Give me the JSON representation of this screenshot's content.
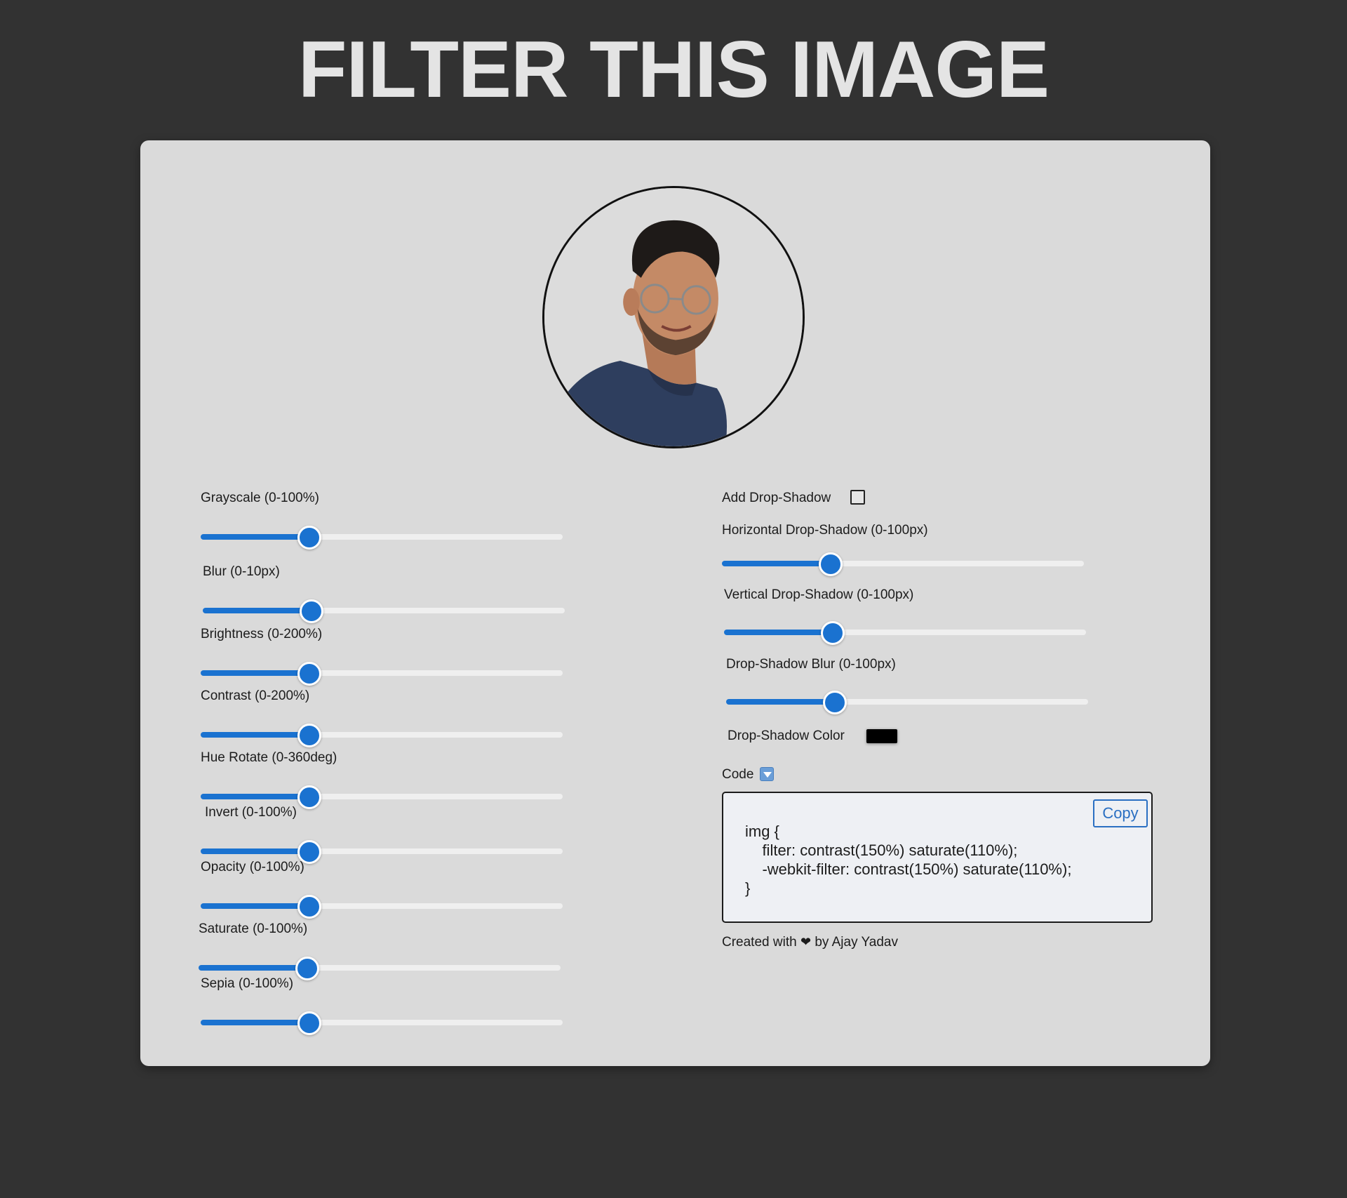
{
  "title": "FILTER THIS IMAGE",
  "colors": {
    "background": "#323232",
    "card": "#dadada",
    "accent": "#1a72d0",
    "shadow_color": "#000000"
  },
  "avatar": {
    "alt": "profile photo",
    "icon": "person-photo"
  },
  "filters": [
    {
      "label": "Grayscale (0-100%)",
      "value_fraction": 0.3
    },
    {
      "label": "Blur (0-10px)",
      "value_fraction": 0.3
    },
    {
      "label": "Brightness (0-200%)",
      "value_fraction": 0.3
    },
    {
      "label": "Contrast (0-200%)",
      "value_fraction": 0.3
    },
    {
      "label": "Hue Rotate (0-360deg)",
      "value_fraction": 0.3
    },
    {
      "label": "Invert (0-100%)",
      "value_fraction": 0.3
    },
    {
      "label": "Opacity (0-100%)",
      "value_fraction": 0.3
    },
    {
      "label": "Saturate (0-100%)",
      "value_fraction": 0.3
    },
    {
      "label": "Sepia (0-100%)",
      "value_fraction": 0.3
    }
  ],
  "shadow": {
    "add_label": "Add Drop-Shadow",
    "enabled": false,
    "sliders": [
      {
        "label": "Horizontal Drop-Shadow (0-100px)",
        "value_fraction": 0.3
      },
      {
        "label": "Vertical Drop-Shadow (0-100px)",
        "value_fraction": 0.3
      },
      {
        "label": "Drop-Shadow Blur (0-100px)",
        "value_fraction": 0.3
      }
    ],
    "color_label": "Drop-Shadow Color",
    "color_value": "#000000"
  },
  "code": {
    "label": "Code",
    "toggle_icon": "arrow-down-square-icon",
    "copy_label": "Copy",
    "text": "img {\n    filter: contrast(150%) saturate(110%);\n    -webkit-filter: contrast(150%) saturate(110%);\n}"
  },
  "credit": {
    "prefix": "Created with",
    "heart": "❤",
    "suffix": "by Ajay Yadav"
  }
}
